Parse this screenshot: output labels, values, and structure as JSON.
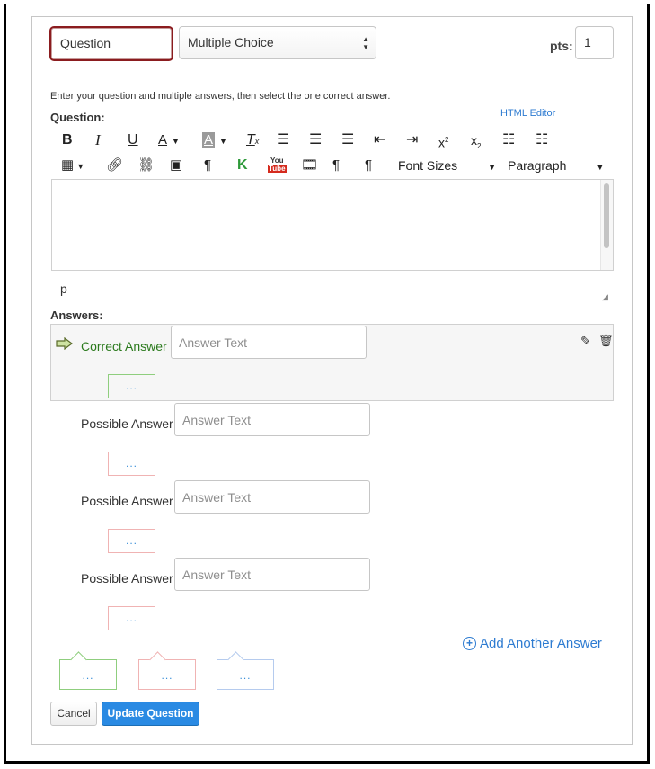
{
  "header": {
    "question_name": "Question",
    "question_type": "Multiple Choice",
    "points_label": "pts:",
    "points_value": "1"
  },
  "editor": {
    "instructions": "Enter your question and multiple answers, then select the one correct answer.",
    "question_label": "Question:",
    "html_editor_link": "HTML Editor",
    "toolbar_row1": [
      "bold-icon",
      "italic-icon",
      "underline-icon",
      "text-color-icon",
      "background-color-icon",
      "clear-formatting-icon",
      "align-left-icon",
      "align-center-icon",
      "align-right-icon",
      "outdent-icon",
      "indent-icon",
      "superscript-icon",
      "subscript-icon",
      "bullet-list-icon",
      "numbered-list-icon"
    ],
    "toolbar_row2": [
      "table-icon",
      "link-icon",
      "unlink-icon",
      "image-icon",
      "paragraph-icon",
      "kaltura-icon",
      "youtube-icon",
      "media-icon",
      "ltr-icon",
      "rtl-icon"
    ],
    "font_sizes_label": "Font Sizes",
    "paragraph_label": "Paragraph",
    "path_indicator": "p"
  },
  "answers": {
    "label": "Answers:",
    "correct_label": "Correct Answer",
    "possible_label": "Possible Answer",
    "placeholder": "Answer Text",
    "comment_dots": "...",
    "add_another": "Add Another Answer"
  },
  "general_comments": {
    "dots": "..."
  },
  "colors": {
    "correct_green": "#2b7a1d",
    "link_blue": "#2d7bd1",
    "primary_button": "#2a8ae3",
    "focus_border": "#8b1c1f"
  },
  "buttons": {
    "cancel": "Cancel",
    "update": "Update Question"
  }
}
